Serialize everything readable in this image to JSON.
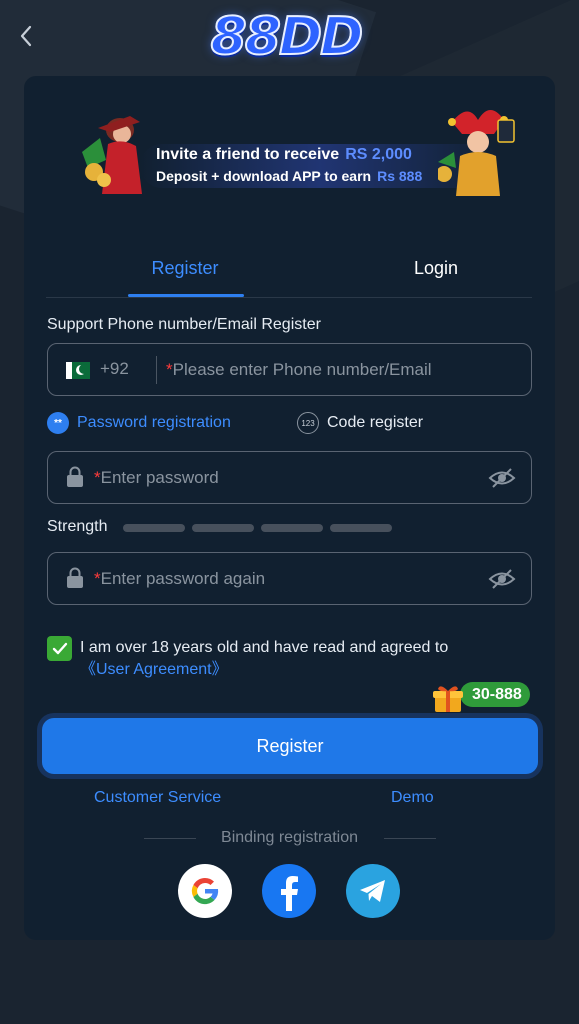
{
  "header": {
    "back_icon": "chevron-left-icon",
    "logo_text": "88DD"
  },
  "banner": {
    "line1": "Invite a friend to receive",
    "line1_amount": "RS 2,000",
    "line2": "Deposit + download APP to earn",
    "line2_amount": "Rs 888"
  },
  "tabs": {
    "register": "Register",
    "login": "Login"
  },
  "form": {
    "support_label": "Support Phone number/Email Register",
    "country_code": "+92",
    "phone_placeholder": "Please enter Phone number/Email",
    "password_registration": "Password registration",
    "password_registration_icon": "**",
    "code_register": "Code register",
    "code_register_icon": "123",
    "password_placeholder": "Enter password",
    "password_again_placeholder": "Enter password again",
    "strength_label": "Strength",
    "required_mark": "*"
  },
  "agreement": {
    "checked": true,
    "text": "I am over 18 years old and have read and agreed to",
    "link": "《User Agreement》"
  },
  "bonus": {
    "label": "30-888"
  },
  "actions": {
    "register_button": "Register",
    "customer_service": "Customer Service",
    "demo": "Demo"
  },
  "binding": {
    "label": "Binding registration",
    "providers": [
      "google-icon",
      "facebook-icon",
      "telegram-icon"
    ]
  },
  "colors": {
    "accent": "#1f78e8",
    "link": "#3d8dff",
    "card": "#112030",
    "check": "#3aa935",
    "bonus_pill": "#2f9b3a"
  }
}
